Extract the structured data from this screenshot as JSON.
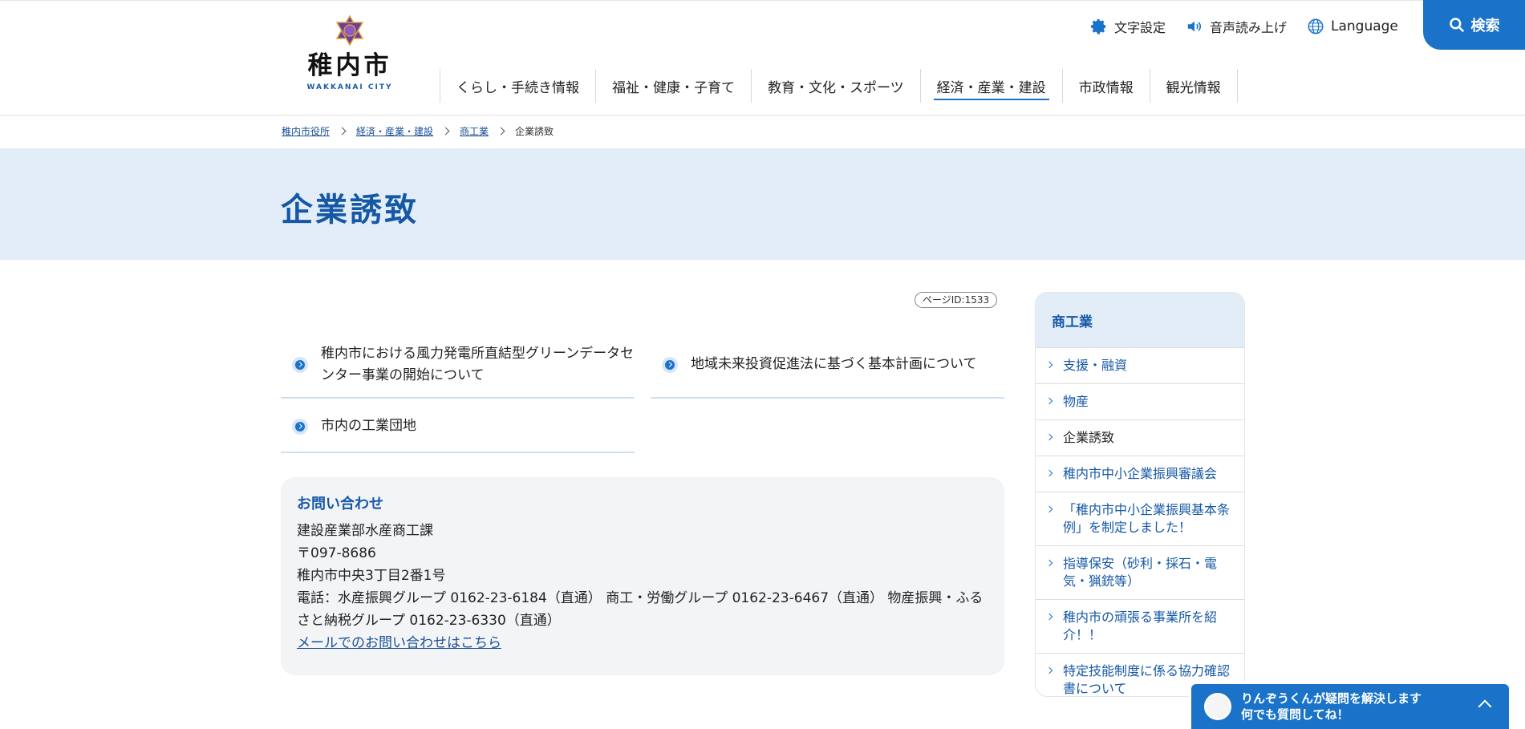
{
  "header": {
    "logo_text": "稚内市",
    "logo_sub": "WAKKANAI CITY",
    "util_font": "文字設定",
    "util_voice": "音声読み上げ",
    "util_lang": "Language",
    "search_label": "検索"
  },
  "gnav": [
    "くらし・手続き情報",
    "福祉・健康・子育て",
    "教育・文化・スポーツ",
    "経済・産業・建設",
    "市政情報",
    "観光情報"
  ],
  "breadcrumb": {
    "items": [
      "稚内市役所",
      "経済・産業・建設",
      "商工業"
    ],
    "current": "企業誘致"
  },
  "page": {
    "title": "企業誘致",
    "page_id": "ページID:1533"
  },
  "links": [
    "稚内市における風力発電所直結型グリーンデータセンター事業の開始について",
    "地域未来投資促進法に基づく基本計画について",
    "市内の工業団地"
  ],
  "contact": {
    "heading": "お問い合わせ",
    "dept": "建設産業部水産商工課",
    "zip": "〒097-8686",
    "address": "稚内市中央3丁目2番1号",
    "tel": "電話：水産振興グループ 0162-23-6184（直通） 商工・労働グループ 0162-23-6467（直通） 物産振興・ふるさと納税グループ 0162-23-6330（直通）",
    "mail_link": "メールでのお問い合わせはこちら"
  },
  "side": {
    "heading": "商工業",
    "items": [
      "支援・融資",
      "物産",
      "企業誘致",
      "稚内市中小企業振興審議会",
      "「稚内市中小企業振興基本条例」を制定しました！",
      "指導保安（砂利・採石・電気・猟銃等）",
      "稚内市の頑張る事業所を紹介！！",
      "特定技能制度に係る協力確認書について"
    ],
    "current_index": 2
  },
  "chat": {
    "line1": "りんぞうくんが疑問を解決します",
    "line2": "何でも質問してね！"
  },
  "colors": {
    "brand_blue": "#1a73c8",
    "title_blue": "#1558a6",
    "band_bg": "#e3edf7"
  },
  "icons": [
    "gear-icon",
    "speaker-icon",
    "globe-icon",
    "search-icon",
    "city-emblem-icon"
  ]
}
